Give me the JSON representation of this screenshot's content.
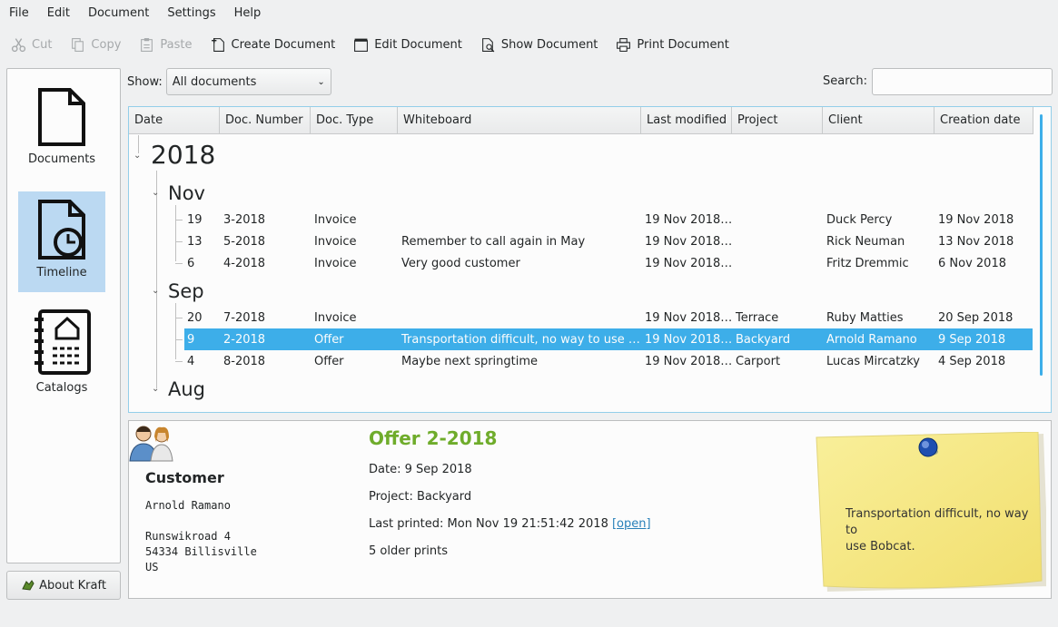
{
  "menu": [
    "File",
    "Edit",
    "Document",
    "Settings",
    "Help"
  ],
  "toolbar": {
    "cut": "Cut",
    "copy": "Copy",
    "paste": "Paste",
    "create": "Create Document",
    "edit": "Edit Document",
    "show": "Show Document",
    "print": "Print Document"
  },
  "sidebar": {
    "documents": "Documents",
    "timeline": "Timeline",
    "catalogs": "Catalogs"
  },
  "about_button": "About Kraft",
  "filter": {
    "show_label": "Show:",
    "show_value": "All documents",
    "search_label": "Search:",
    "search_value": ""
  },
  "columns": [
    "Date",
    "Doc. Number",
    "Doc. Type",
    "Whiteboard",
    "Last modified",
    "Project",
    "Client",
    "Creation date"
  ],
  "tree": {
    "year": "2018",
    "months": [
      {
        "name": "Nov",
        "rows": [
          {
            "day": "19",
            "number": "3-2018",
            "type": "Invoice",
            "whiteboard": "",
            "modified": "19 Nov 2018 ...",
            "project": "",
            "client": "Duck Percy",
            "created": "19 Nov 2018"
          },
          {
            "day": "13",
            "number": "5-2018",
            "type": "Invoice",
            "whiteboard": "Remember to call again in May",
            "modified": "19 Nov 2018 ...",
            "project": "",
            "client": "Rick Neuman",
            "created": "13 Nov 2018"
          },
          {
            "day": "6",
            "number": "4-2018",
            "type": "Invoice",
            "whiteboard": "Very good customer",
            "modified": "19 Nov 2018 ...",
            "project": "",
            "client": "Fritz Dremmic",
            "created": "6 Nov 2018"
          }
        ]
      },
      {
        "name": "Sep",
        "rows": [
          {
            "day": "20",
            "number": "7-2018",
            "type": "Invoice",
            "whiteboard": "",
            "modified": "19 Nov 2018 ...",
            "project": "Terrace",
            "client": "Ruby Matties",
            "created": "20 Sep 2018"
          },
          {
            "day": "9",
            "number": "2-2018",
            "type": "Offer",
            "whiteboard": "Transportation difficult, no way to use Bo...",
            "modified": "19 Nov 2018 ...",
            "project": "Backyard",
            "client": "Arnold Ramano",
            "created": "9 Sep 2018",
            "selected": true
          },
          {
            "day": "4",
            "number": "8-2018",
            "type": "Offer",
            "whiteboard": "Maybe next springtime",
            "modified": "19 Nov 2018 ...",
            "project": "Carport",
            "client": "Lucas Mircatzky",
            "created": "4 Sep 2018"
          }
        ]
      },
      {
        "name": "Aug",
        "rows": []
      }
    ]
  },
  "detail": {
    "customer_heading": "Customer",
    "customer_name": "Arnold Ramano",
    "address_street": "Runswikroad 4",
    "address_city": "54334 Billisville",
    "address_country": "US",
    "doc_title": "Offer 2-2018",
    "date_line": "Date: 9 Sep 2018",
    "project_line": "Project: Backyard",
    "printed_line": "Last printed: Mon Nov 19 21:51:42 2018",
    "open_link": "[open]",
    "older_prints": "5 older prints",
    "note_line1": "Transportation difficult, no way to",
    "note_line2": "use Bobcat."
  },
  "colors": {
    "accent": "#3daee9",
    "selected_sidebar": "#bbd9f2",
    "doc_title": "#6fac2b",
    "note": "#f7ec8d"
  }
}
